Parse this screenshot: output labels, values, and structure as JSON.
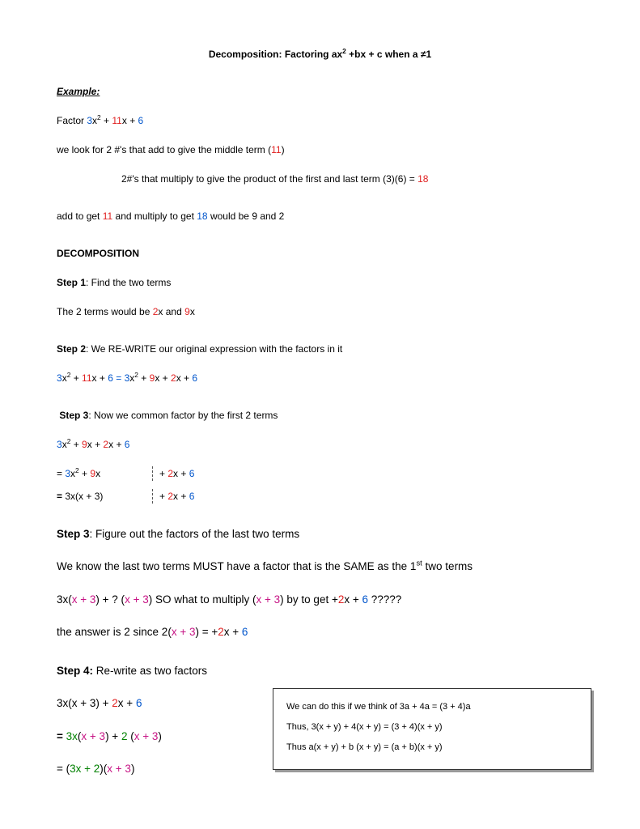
{
  "title_pre": "Decomposition:  Factoring ax",
  "title_mid": " +bx + c when a ",
  "title_end": "1",
  "example_label": "Example:",
  "factor_word": "Factor   ",
  "p1_look": "we look for 2 #'s that add to give the middle term (",
  "p1_close": ")",
  "p2_pre": "2#'s that multiply to give the product of the first and last term (3)(6) = ",
  "p3_a": "add to get ",
  "p3_b": " and multiply to get ",
  "p3_c": "    would be  9 and 2",
  "decomp_heading": "DECOMPOSITION",
  "step1_label": "Step 1",
  "step1_text": ":  Find the two terms",
  "step1_line2a": "The 2 terms would be ",
  "step1_line2b": "x and ",
  "step1_line2c": "x",
  "step2_label": "Step 2",
  "step2_text": ":  We RE-WRITE our original expression with the factors in it",
  "eq_sign": "  =  ",
  "step3a_label": "Step 3",
  "step3a_text": ": Now we common factor by  the first 2 terms",
  "row_eq": "=  ",
  "row_eq_bold": "= ",
  "row_3xx3": "3x(x + 3)",
  "plus_2x_6_a": "+ ",
  "plus_2x_6_b": "x + ",
  "step3b_label": "Step 3",
  "step3b_text": ": Figure out the factors of the last two terms",
  "must_a": "We know the last two terms MUST have a factor that is the SAME as the 1",
  "must_b": "  two terms",
  "so_a": "3x(",
  "so_b": ")    + ? (",
  "so_c": ")    SO what to multiply (",
  "so_d": ") by to get +",
  "so_e": "x + ",
  "so_f": "  ?????",
  "ans_a": "the answer is 2 since        2(",
  "ans_b": ")  = +",
  "ans_c": "x + ",
  "step4_label": "Step 4:",
  "step4_text": "  Re-write as two factors",
  "r1_a": "3x(x + 3)    + ",
  "r1_b": "x + ",
  "r2_a": "= ",
  "r2_b": "3x",
  "r2_c": "(",
  "r2_d": "x + 3",
  "r2_e": ")    + ",
  "r2_f": "2 ",
  "r2_g": "(",
  "r2_h": "x + 3",
  "r2_i": ")",
  "r3_a": "= (",
  "r3_b": "3x + 2",
  "r3_c": ")(",
  "r3_d": "x + 3",
  "r3_e": ")",
  "note1": "We can do this if we think of 3a + 4a = (3 + 4)a",
  "note2": "Thus, 3(x + y) + 4(x + y) = (3 + 4)(x + y)",
  "note3": "Thus  a(x + y) + b (x + y) = (a + b)(x + y)",
  "n2": "2",
  "n3": "3",
  "n6": "6",
  "n9": "9",
  "n11": "11",
  "n18": "18",
  "x": "x",
  "xp3": "x + 3",
  "st": "st",
  "sq": "2",
  "ne": "≠"
}
